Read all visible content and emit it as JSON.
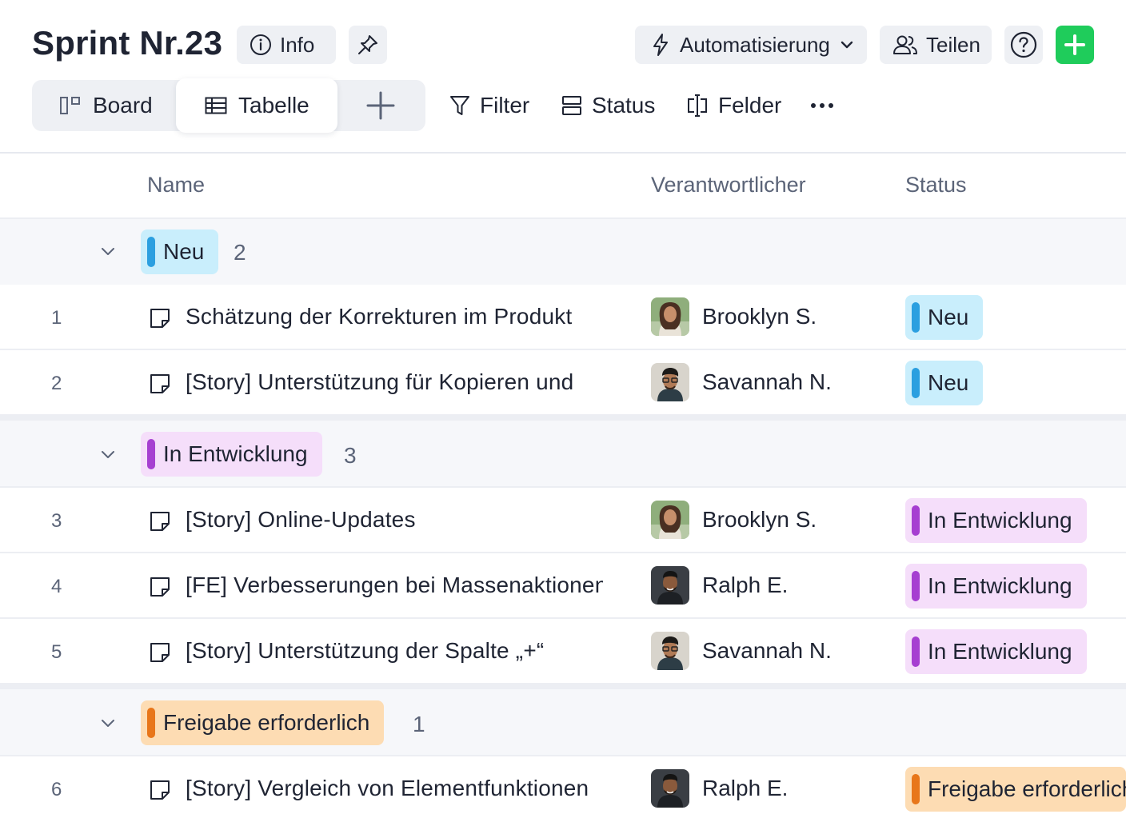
{
  "header": {
    "title": "Sprint Nr.23",
    "info_label": "Info",
    "automation_label": "Automatisierung",
    "share_label": "Teilen"
  },
  "views": {
    "board_label": "Board",
    "table_label": "Tabelle"
  },
  "toolbar": {
    "filter_label": "Filter",
    "status_label": "Status",
    "fields_label": "Felder"
  },
  "table": {
    "columns": [
      "Name",
      "Verantwortlicher",
      "Status"
    ]
  },
  "colors": {
    "accent_green": "#1fcc5b",
    "neu_bg": "#c9eefc",
    "neu_bar": "#2b9fe0",
    "dev_bg": "#f5defa",
    "dev_bar": "#a63fd1",
    "approval_bg": "#fddcb3",
    "approval_bar": "#e8761a"
  },
  "groups": [
    {
      "label": "Neu",
      "count": "2"
    },
    {
      "label": "In Entwicklung",
      "count": "3"
    },
    {
      "label": "Freigabe erforderlich",
      "count": "1"
    }
  ],
  "rows": [
    {
      "num": "1",
      "name": "Schätzung der Korrekturen im Produkt",
      "person": "Brooklyn S.",
      "status": "Neu"
    },
    {
      "num": "2",
      "name": "[Story] Unterstützung für Kopieren und",
      "person": "Savannah N.",
      "status": "Neu"
    },
    {
      "num": "3",
      "name": "[Story] Online-Updates",
      "person": "Brooklyn S.",
      "status": "In Entwicklung"
    },
    {
      "num": "4",
      "name": "[FE] Verbesserungen bei Massenaktionen",
      "person": "Ralph E.",
      "status": "In Entwicklung"
    },
    {
      "num": "5",
      "name": "[Story] Unterstützung der Spalte „+“",
      "person": "Savannah N.",
      "status": "In Entwicklung"
    },
    {
      "num": "6",
      "name": "[Story] Vergleich von Elementfunktionen",
      "person": "Ralph E.",
      "status": "Freigabe erforderlich"
    }
  ]
}
